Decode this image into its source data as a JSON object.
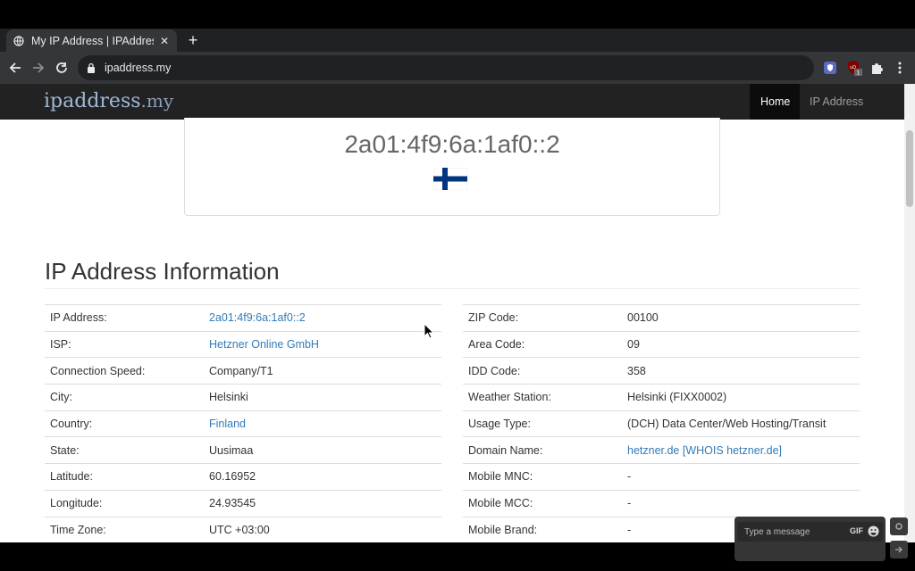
{
  "browser": {
    "tab_title": "My IP Address | IPAddress.my",
    "url": "ipaddress.my",
    "ext_badge": "1"
  },
  "site": {
    "brand_name": "ipaddress",
    "brand_tld": ".my",
    "nav": {
      "home": "Home",
      "ip_address": "IP Address"
    }
  },
  "ip_card": {
    "ip": "2a01:4f9:6a:1af0::2",
    "flag": "finland-flag"
  },
  "section_title": "IP Address Information",
  "left_rows": [
    {
      "label": "IP Address:",
      "value": "2a01:4f9:6a:1af0::2",
      "link": true
    },
    {
      "label": "ISP:",
      "value": "Hetzner Online GmbH",
      "link": true
    },
    {
      "label": "Connection Speed:",
      "value": "Company/T1",
      "link": false
    },
    {
      "label": "City:",
      "value": "Helsinki",
      "link": false
    },
    {
      "label": "Country:",
      "value": "Finland",
      "link": true
    },
    {
      "label": "State:",
      "value": "Uusimaa",
      "link": false
    },
    {
      "label": "Latitude:",
      "value": "60.16952",
      "link": false
    },
    {
      "label": "Longitude:",
      "value": "24.93545",
      "link": false
    },
    {
      "label": "Time Zone:",
      "value": "UTC +03:00",
      "link": false
    }
  ],
  "right_rows": [
    {
      "label": "ZIP Code:",
      "value": "00100",
      "link": false
    },
    {
      "label": "Area Code:",
      "value": "09",
      "link": false
    },
    {
      "label": "IDD Code:",
      "value": "358",
      "link": false
    },
    {
      "label": "Weather Station:",
      "value": "Helsinki (FIXX0002)",
      "link": false
    },
    {
      "label": "Usage Type:",
      "value": "(DCH) Data Center/Web Hosting/Transit",
      "link": false
    },
    {
      "label": "Domain Name:",
      "value": "hetzner.de [WHOIS hetzner.de]",
      "link": true
    },
    {
      "label": "Mobile MNC:",
      "value": "-",
      "link": false
    },
    {
      "label": "Mobile MCC:",
      "value": "-",
      "link": false
    },
    {
      "label": "Mobile Brand:",
      "value": "-",
      "link": false
    }
  ],
  "chat": {
    "placeholder": "Type a message",
    "gif_label": "GIF"
  },
  "colors": {
    "link": "#337ab7",
    "navbar": "#222222",
    "chrome_tab": "#35363a"
  }
}
